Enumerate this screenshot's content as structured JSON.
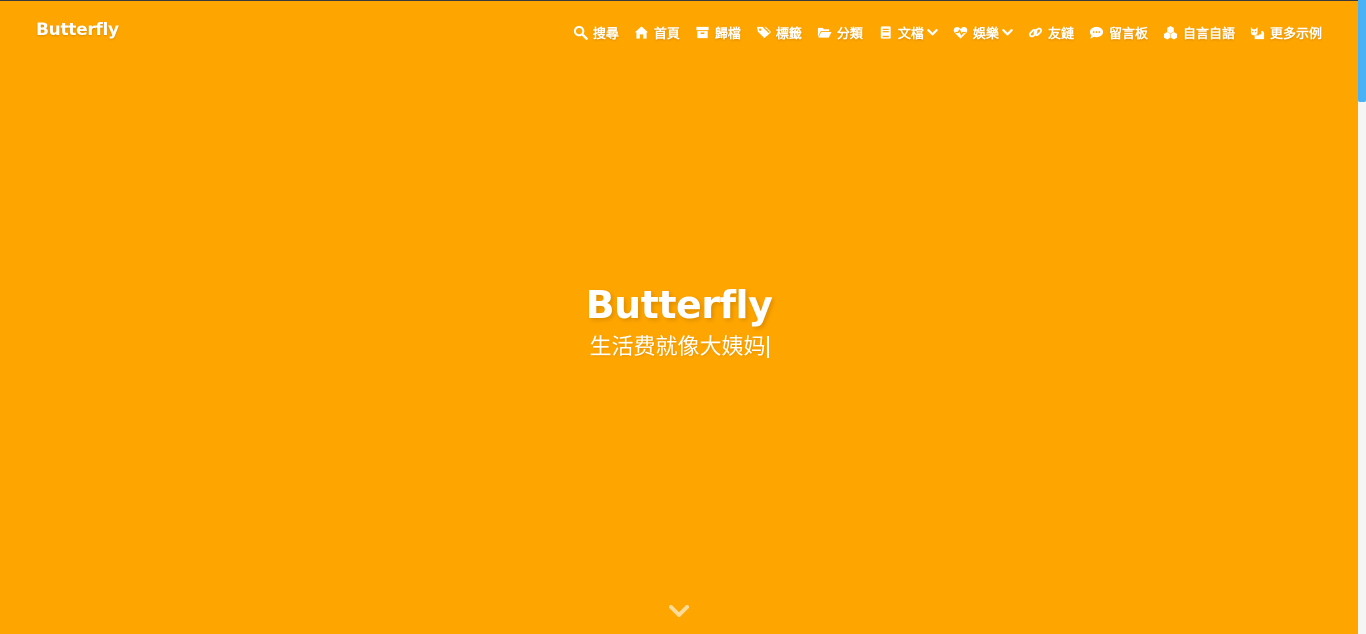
{
  "site": {
    "name": "Butterfly"
  },
  "nav": {
    "items": [
      {
        "label": "搜尋",
        "icon": "search-icon"
      },
      {
        "label": "首頁",
        "icon": "home-icon"
      },
      {
        "label": "歸檔",
        "icon": "archive-icon"
      },
      {
        "label": "標籤",
        "icon": "tags-icon"
      },
      {
        "label": "分類",
        "icon": "folder-open-icon"
      },
      {
        "label": "文檔",
        "icon": "book-icon",
        "dropdown": true
      },
      {
        "label": "娛樂",
        "icon": "heartbeat-icon",
        "dropdown": true
      },
      {
        "label": "友鏈",
        "icon": "link-icon"
      },
      {
        "label": "留言板",
        "icon": "comment-dots-icon"
      },
      {
        "label": "自言自語",
        "icon": "cubes-icon"
      },
      {
        "label": "更多示例",
        "icon": "cat-icon"
      }
    ]
  },
  "hero": {
    "title": "Butterfly",
    "subtitle": "生活费就像大姨妈"
  },
  "colors": {
    "background": "#ffa500",
    "text": "#ffffff",
    "scrollbar_thumb": "#49b1f5"
  }
}
